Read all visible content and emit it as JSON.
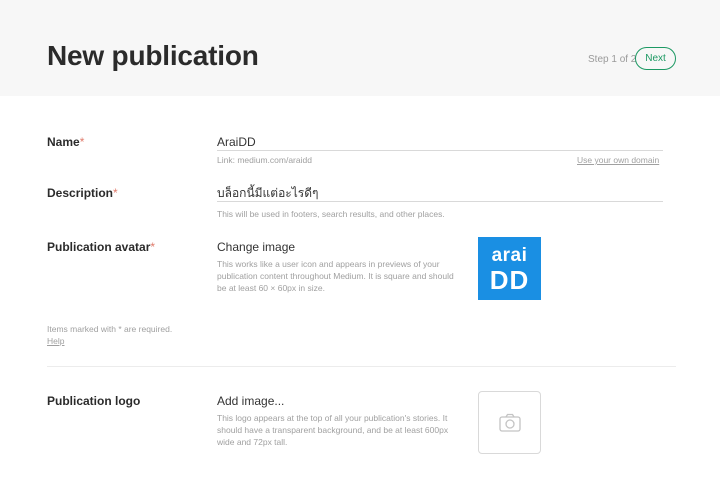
{
  "header": {
    "title": "New publication",
    "step": "Step 1 of 2",
    "next_label": "Next"
  },
  "form": {
    "name": {
      "label": "Name",
      "required_mark": "*",
      "value": "AraiDD",
      "link_hint": "Link: medium.com/araidd",
      "own_domain_link": "Use your own domain"
    },
    "description": {
      "label": "Description",
      "required_mark": "*",
      "value": "บล็อกนี้มีแต่อะไรดีๆ",
      "hint": "This will be used in footers, search results, and other places."
    },
    "avatar": {
      "label": "Publication avatar",
      "required_mark": "*",
      "action": "Change image",
      "hint": "This works like a user icon and appears in previews of your publication content throughout Medium. It is square and should be at least 60 × 60px in size.",
      "image_text_line1": "arai",
      "image_text_line2": "DD",
      "image_color": "#1a8fe3"
    },
    "required_note": "Items marked with * are required.",
    "help_link": "Help",
    "logo": {
      "label": "Publication logo",
      "action": "Add image...",
      "hint": "This logo appears at the top of all your publication's stories. It should have a transparent background, and be at least 600px wide and 72px tall.",
      "placeholder_icon": "camera-icon"
    }
  },
  "colors": {
    "accent": "#1c9963",
    "required": "#e07b6b",
    "header_bg": "#f7f7f7"
  }
}
